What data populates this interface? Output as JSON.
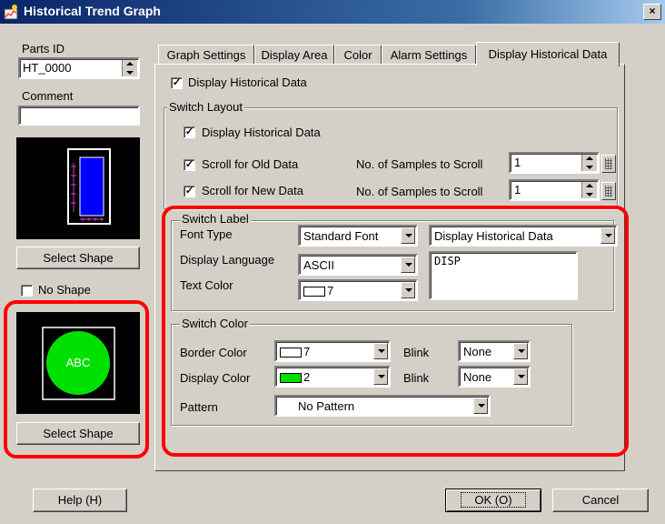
{
  "window": {
    "title": "Historical Trend Graph",
    "close_glyph": "×"
  },
  "left": {
    "parts_id_label": "Parts ID",
    "parts_id_value": "HT_0000",
    "comment_label": "Comment",
    "comment_value": "",
    "select_shape_1": "Select Shape",
    "no_shape_label": "No Shape",
    "no_shape_checked": false,
    "preview2_text": "ABC",
    "select_shape_2": "Select Shape"
  },
  "tabs": [
    "Graph Settings",
    "Display Area",
    "Color",
    "Alarm Settings",
    "Display Historical Data"
  ],
  "active_tab": "Display Historical Data",
  "display_historical_checkbox": {
    "label": "Display Historical Data",
    "checked": true
  },
  "switch_layout": {
    "title": "Switch Layout",
    "display_historical": {
      "label": "Display Historical Data",
      "checked": true
    },
    "scroll_old": {
      "label": "Scroll for Old Data",
      "checked": true,
      "samples_label": "No. of Samples to Scroll",
      "samples_value": "1"
    },
    "scroll_new": {
      "label": "Scroll for New Data",
      "checked": true,
      "samples_label": "No. of Samples to Scroll",
      "samples_value": "1"
    }
  },
  "switch_label": {
    "title": "Switch Label",
    "font_type_label": "Font Type",
    "font_type_value": "Standard Font",
    "label_select_value": "Display Historical Data",
    "display_language_label": "Display Language",
    "display_language_value": "ASCII",
    "label_text": "DISP",
    "text_color_label": "Text Color",
    "text_color_value": "7"
  },
  "switch_color": {
    "title": "Switch Color",
    "border_color_label": "Border Color",
    "border_color_value": "7",
    "border_blink_label": "Blink",
    "border_blink_value": "None",
    "display_color_label": "Display Color",
    "display_color_value": "2",
    "display_blink_label": "Blink",
    "display_blink_value": "None",
    "pattern_label": "Pattern",
    "pattern_value": "No Pattern"
  },
  "footer": {
    "help": "Help (H)",
    "ok": "OK (O)",
    "cancel": "Cancel"
  },
  "colors": {
    "highlight_red": "#ff0000",
    "switch_green": "#00e000",
    "preview_blue": "#0000ff",
    "title_blue": "#0a246a"
  }
}
